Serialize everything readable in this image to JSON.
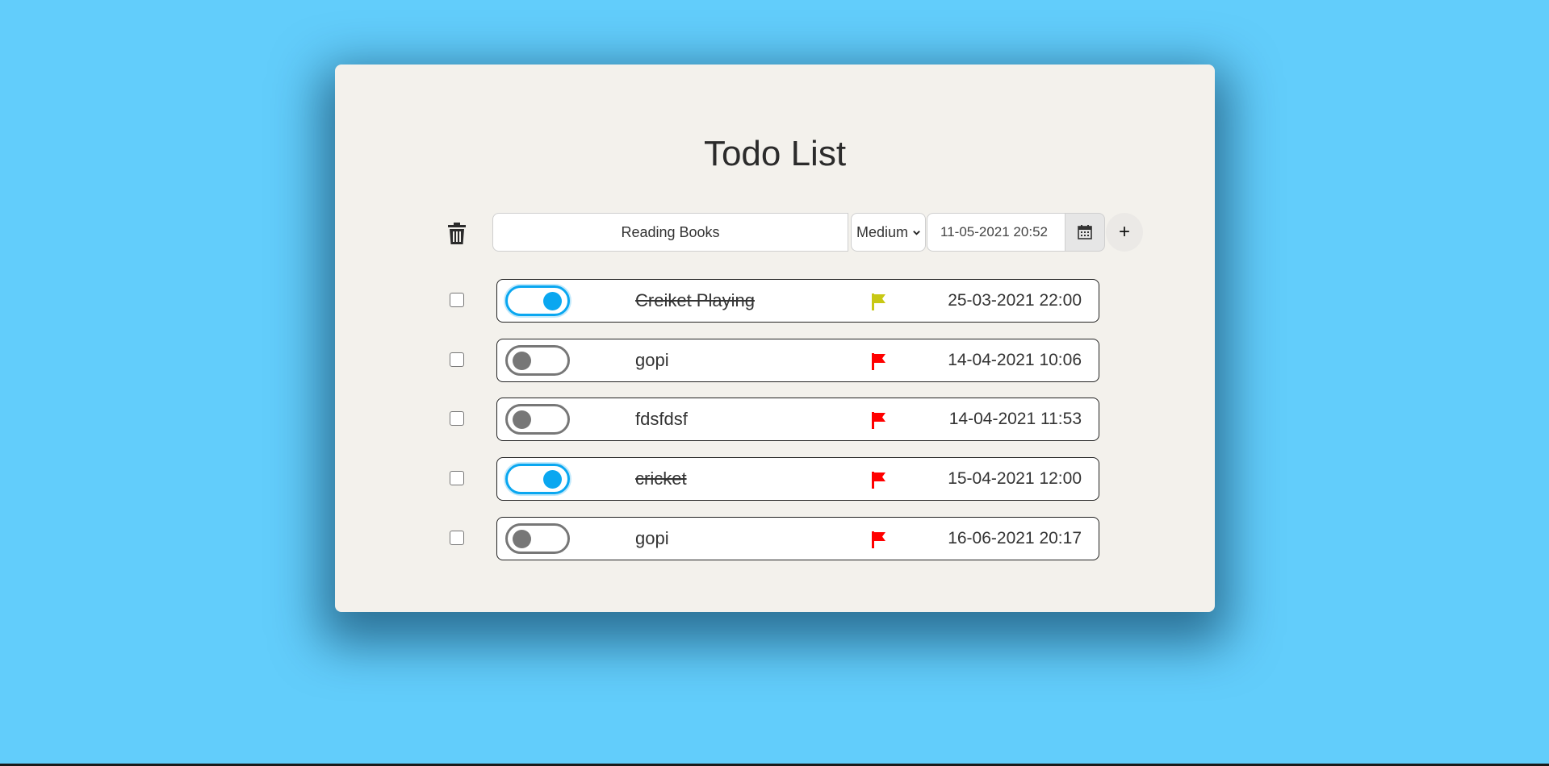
{
  "title": "Todo List",
  "new_task": {
    "value": "Reading Books",
    "priority": "Medium",
    "datetime": "11-05-2021 20:52",
    "add_label": "+"
  },
  "colors": {
    "background": "#62cdfb",
    "card": "#f3f1ec",
    "toggle_on": "#0aa7f0",
    "toggle_off": "#777777",
    "flag_medium": "#c8c814",
    "flag_high": "#ff0000"
  },
  "tasks": [
    {
      "name": "Creiket Playing",
      "done": true,
      "priority_color": "#c8c814",
      "datetime": "25-03-2021 22:00"
    },
    {
      "name": "gopi",
      "done": false,
      "priority_color": "#ff0000",
      "datetime": "14-04-2021 10:06"
    },
    {
      "name": "fdsfdsf",
      "done": false,
      "priority_color": "#ff0000",
      "datetime": "14-04-2021 11:53"
    },
    {
      "name": "cricket",
      "done": true,
      "priority_color": "#ff0000",
      "datetime": "15-04-2021 12:00"
    },
    {
      "name": "gopi",
      "done": false,
      "priority_color": "#ff0000",
      "datetime": "16-06-2021 20:17"
    }
  ]
}
